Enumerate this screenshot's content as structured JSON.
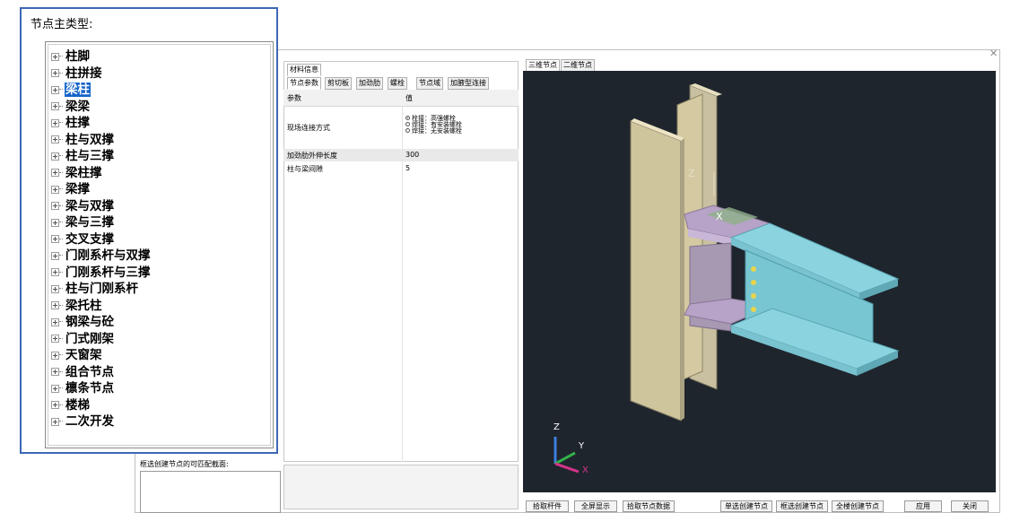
{
  "tree_popup": {
    "title": "节点主类型:",
    "items": [
      {
        "label": "柱脚"
      },
      {
        "label": "柱拼接"
      },
      {
        "label": "梁柱",
        "selected": true
      },
      {
        "label": "梁梁"
      },
      {
        "label": "柱撑"
      },
      {
        "label": "柱与双撑"
      },
      {
        "label": "柱与三撑"
      },
      {
        "label": "梁柱撑"
      },
      {
        "label": "梁撑"
      },
      {
        "label": "梁与双撑"
      },
      {
        "label": "梁与三撑"
      },
      {
        "label": "交叉支撑"
      },
      {
        "label": "门刚系杆与双撑"
      },
      {
        "label": "门刚系杆与三撑"
      },
      {
        "label": "柱与门刚系杆"
      },
      {
        "label": "梁托柱"
      },
      {
        "label": "钢梁与砼"
      },
      {
        "label": "门式刚架"
      },
      {
        "label": "天窗架"
      },
      {
        "label": "组合节点"
      },
      {
        "label": "檩条节点"
      },
      {
        "label": "楼梯"
      },
      {
        "label": "二次开发"
      }
    ]
  },
  "left_strip": {
    "label": "框选创建节点的可匹配截面:"
  },
  "params_panel": {
    "top_tab": "材料信息",
    "tabs": [
      "节点参数",
      "剪切板",
      "加劲肋",
      "螺栓",
      "节点域",
      "加腋型连接"
    ],
    "header": {
      "param": "参数",
      "value": "值"
    },
    "rows": [
      {
        "param": "现场连接方式",
        "options": [
          "栓接：高强螺栓",
          "焊接：有安装螺栓",
          "焊接：无安装螺栓"
        ],
        "selected_option": 0
      },
      {
        "param": "加劲肋外伸长度",
        "value": "300"
      },
      {
        "param": "柱与梁间隙",
        "value": "5"
      }
    ]
  },
  "view_tabs": [
    "三维节点",
    "二维节点"
  ],
  "viewport": {
    "background": "#1f252d",
    "axis_labels": {
      "z": "Z",
      "x": "X",
      "y": "Y"
    }
  },
  "buttons": {
    "pick_member": "拾取杆件",
    "fullscreen": "全屏显示",
    "pick_node_data": "拾取节点数据",
    "single_create": "单选创建节点",
    "box_create": "框选创建节点",
    "all_create": "全楼创建节点",
    "apply": "应用",
    "close": "关闭"
  },
  "close_icon": "close-icon"
}
